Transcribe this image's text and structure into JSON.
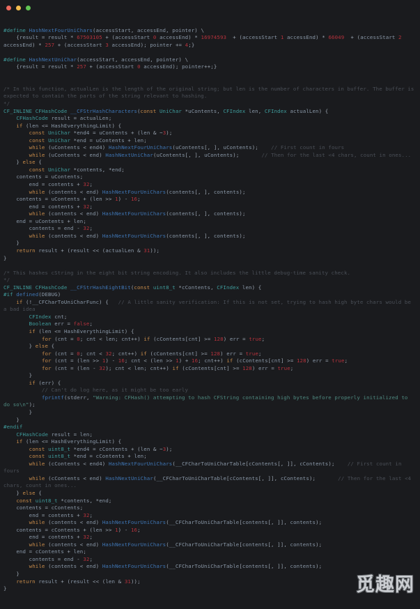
{
  "window": {
    "background_color": "#1a1b1e",
    "titlebar": {
      "buttons": [
        {
          "name": "close",
          "color": "#ec6a5f"
        },
        {
          "name": "minimize",
          "color": "#f4bd4f"
        },
        {
          "name": "maximize",
          "color": "#61c554"
        }
      ]
    }
  },
  "theme": {
    "comment": "#4a4f57",
    "string": "#4f8a80",
    "number": "#b5323c",
    "keyword": "#c78b4a",
    "type": "#3f9c9c",
    "function": "#3f76b5",
    "preprocessor": "#3f9c9c",
    "plain": "#b9c2cc",
    "variable": "#8a98a8"
  },
  "watermark": {
    "text": "觅趣网"
  },
  "code": {
    "language": "c",
    "lines": [
      "",
      "#define HashNextFourUniChars(accessStart, accessEnd, pointer) \\",
      "    {result = result * 67503105 + (accessStart 0 accessEnd) * 16974593  + (accessStart 1 accessEnd) * 66049  + (accessStart 2 accessEnd) * 257 + (accessStart 3 accessEnd); pointer += 4;}",
      "",
      "#define HashNextUniChar(accessStart, accessEnd, pointer) \\",
      "    {result = result * 257 + (accessStart 0 accessEnd); pointer++;}",
      "",
      "",
      "/* In this function, actualLen is the length of the original string; but len is the number of characters in buffer. The buffer is expected to contain the parts of the string relevant to hashing.",
      "*/",
      "CF_INLINE CFHashCode __CFStrHashCharacters(const UniChar *uContents, CFIndex len, CFIndex actualLen) {",
      "    CFHashCode result = actualLen;",
      "    if (len <= HashEverythingLimit) {",
      "        const UniChar *end4 = uContents + (len & ~3);",
      "        const UniChar *end = uContents + len;",
      "        while (uContents < end4) HashNextFourUniChars(uContents[, ], uContents);    // First count in fours",
      "        while (uContents < end) HashNextUniChar(uContents[, ], uContents);       // Then for the last <4 chars, count in ones...",
      "    } else {",
      "        const UniChar *contents, *end;",
      "    contents = uContents;",
      "        end = contents + 32;",
      "        while (contents < end) HashNextFourUniChars(contents[, ], contents);",
      "    contents = uContents + (len >> 1) - 16;",
      "        end = contents + 32;",
      "        while (contents < end) HashNextFourUniChars(contents[, ], contents);",
      "    end = uContents + len;",
      "        contents = end - 32;",
      "        while (contents < end) HashNextFourUniChars(contents[, ], contents);",
      "    }",
      "    return result + (result << (actualLen & 31));",
      "}",
      "",
      "/* This hashes cString in the eight bit string encoding. It also includes the little debug-time sanity check.",
      "*/",
      "CF_INLINE CFHashCode __CFStrHashEightBit(const uint8_t *cContents, CFIndex len) {",
      "#if defined(DEBUG)",
      "    if (!__CFCharToUniCharFunc) {   // A little sanity verification: If this is not set, trying to hash high byte chars would be a bad idea",
      "        CFIndex cnt;",
      "        Boolean err = false;",
      "        if (len <= HashEverythingLimit) {",
      "            for (cnt = 0; cnt < len; cnt++) if (cContents[cnt] >= 128) err = true;",
      "        } else {",
      "            for (cnt = 0; cnt < 32; cnt++) if (cContents[cnt] >= 128) err = true;",
      "            for (cnt = (len >> 1) - 16; cnt < (len >> 1) + 16; cnt++) if (cContents[cnt] >= 128) err = true;",
      "            for (cnt = (len - 32); cnt < len; cnt++) if (cContents[cnt] >= 128) err = true;",
      "        }",
      "        if (err) {",
      "            // Can't do log here, as it might be too early",
      "            fprintf(stderr, \"Warning: CFHash() attempting to hash CFString containing high bytes before properly initialized to do so\\n\");",
      "        }",
      "    }",
      "#endif",
      "    CFHashCode result = len;",
      "    if (len <= HashEverythingLimit) {",
      "        const uint8_t *end4 = cContents + (len & ~3);",
      "        const uint8_t *end = cContents + len;",
      "        while (cContents < end4) HashNextFourUniChars(__CFCharToUniCharTable[cContents[, ]], cContents);    // First count in fours",
      "        while (cContents < end) HashNextUniChar(__CFCharToUniCharTable[cContents[, ]], cContents);       // Then for the last <4 chars, count in ones...",
      "    } else {",
      "    const uint8_t *contents, *end;",
      "    contents = cContents;",
      "        end = contents + 32;",
      "        while (contents < end) HashNextFourUniChars(__CFCharToUniCharTable[contents[, ]], contents);",
      "    contents = cContents + (len >> 1) - 16;",
      "        end = contents + 32;",
      "        while (contents < end) HashNextFourUniChars(__CFCharToUniCharTable[contents[, ]], contents);",
      "    end = cContents + len;",
      "        contents = end - 32;",
      "        while (contents < end) HashNextFourUniChars(__CFCharToUniCharTable[contents[, ]], contents);",
      "    }",
      "    return result + (result << (len & 31));",
      "}"
    ]
  }
}
